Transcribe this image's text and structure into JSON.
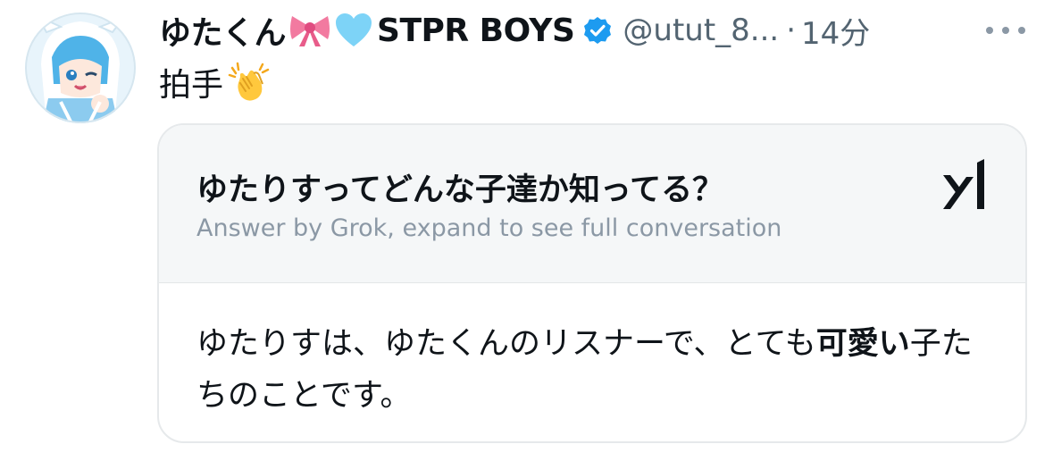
{
  "tweet": {
    "display_name": "ゆたくん",
    "name_suffix": "STPR BOYS",
    "handle": "@utut_8...",
    "dot": "·",
    "time": "14分",
    "text": "拍手",
    "icons": {
      "name_emoji_1": "ribbon-icon",
      "name_emoji_2": "light-blue-heart-icon",
      "verified": "verified-badge-icon",
      "text_emoji": "clapping-hands-icon",
      "more": "more-options-icon"
    },
    "colors": {
      "verified": "#1d9bf0",
      "secondary_text": "#536471",
      "heart": "#7dd3f7",
      "ribbon": "#f27aa0"
    }
  },
  "grok_card": {
    "question": "ゆたりすってどんな子達か知ってる？",
    "subtitle": "Answer by Grok, expand to see full conversation",
    "logo": "xai-grok-logo-icon",
    "answer_part1": "ゆたりすは、ゆたくんのリスナーで、とても",
    "answer_bold": "可愛い",
    "answer_part2": "子たちのことです。"
  }
}
